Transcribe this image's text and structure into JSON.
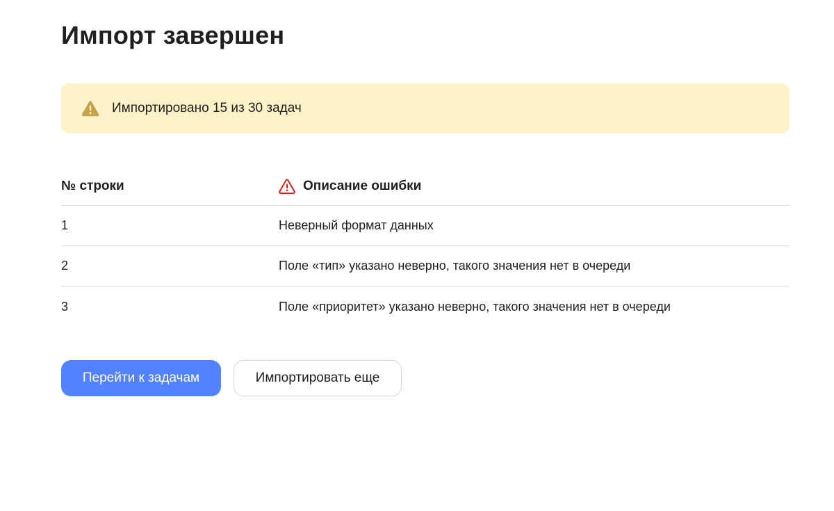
{
  "page": {
    "title": "Импорт завершен"
  },
  "alert": {
    "icon": "warning-triangle-icon",
    "color": "#fef3c8",
    "icon_color": "#c6a04a",
    "text": "Импортировано 15 из 30 задач"
  },
  "table": {
    "columns": {
      "row_number": "№ строки",
      "error_description": "Описание ошибки",
      "error_icon": "error-triangle-icon",
      "error_icon_color": "#d4231b"
    },
    "rows": [
      {
        "row": "1",
        "description": "Неверный формат данных"
      },
      {
        "row": "2",
        "description": "Поле «тип» указано неверно, такого значения нет в очереди"
      },
      {
        "row": "3",
        "description": "Поле «приоритет» указано неверно, такого значения нет в очереди"
      }
    ]
  },
  "actions": {
    "primary_label": "Перейти к задачам",
    "primary_color": "#5282ff",
    "secondary_label": "Импортировать еще"
  }
}
